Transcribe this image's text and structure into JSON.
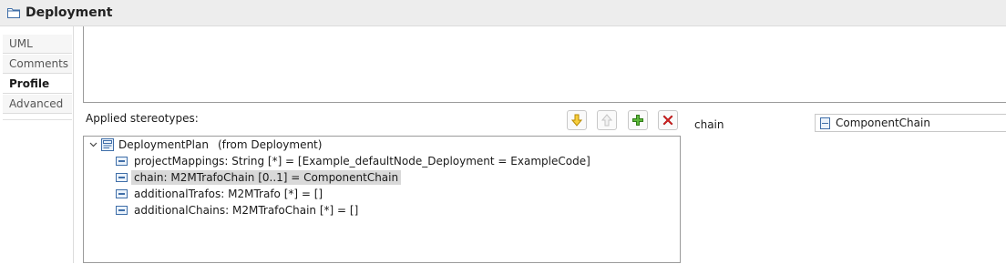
{
  "header": {
    "title": "Deployment"
  },
  "tabs": [
    {
      "label": "UML"
    },
    {
      "label": "Comments"
    },
    {
      "label": "Profile"
    },
    {
      "label": "Advanced"
    }
  ],
  "stereotypes": {
    "label": "Applied stereotypes:",
    "toolbar": {
      "move_down": "arrow-down-icon",
      "move_up": "arrow-up-icon",
      "add": "plus-icon",
      "remove": "delete-icon"
    },
    "tree": {
      "root": {
        "name": "DeploymentPlan",
        "from": "(from Deployment)"
      },
      "properties": [
        {
          "text": "projectMappings: String [*] = [Example_defaultNode_Deployment = ExampleCode]"
        },
        {
          "text": "chain: M2MTrafoChain [0..1] = ComponentChain",
          "selected": true
        },
        {
          "text": "additionalTrafos: M2MTrafo [*] = []"
        },
        {
          "text": "additionalChains: M2MTrafoChain [*] = []"
        }
      ]
    }
  },
  "detail": {
    "property_label": "chain",
    "value": "ComponentChain"
  }
}
